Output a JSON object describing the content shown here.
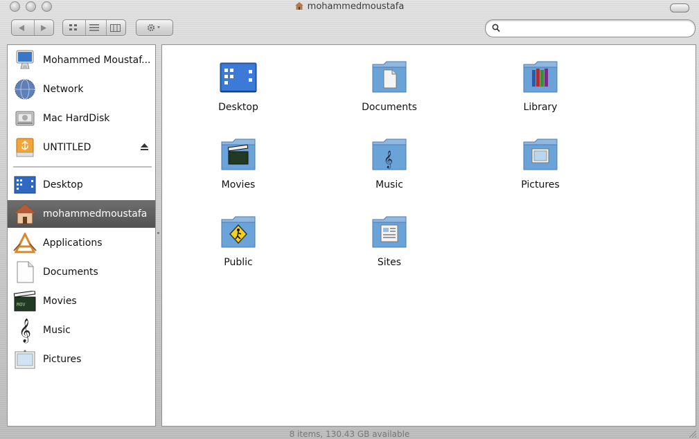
{
  "window": {
    "title": "mohammedmoustafa"
  },
  "toolbar": {
    "back_icon": "back-arrow-icon",
    "forward_icon": "forward-arrow-icon",
    "views": [
      "icon-view-icon",
      "list-view-icon",
      "column-view-icon"
    ],
    "action_icon": "gear-icon",
    "search_value": ""
  },
  "sidebar": {
    "devices": [
      {
        "label": "Mohammed Moustaf...",
        "icon": "computer-icon"
      },
      {
        "label": "Network",
        "icon": "network-globe-icon"
      },
      {
        "label": "Mac HardDisk",
        "icon": "hard-disk-icon"
      },
      {
        "label": "UNTITLED",
        "icon": "usb-drive-icon"
      }
    ],
    "places": [
      {
        "label": "Desktop",
        "icon": "desktop-icon"
      },
      {
        "label": "mohammedmoustafa",
        "icon": "home-icon",
        "selected": true
      },
      {
        "label": "Applications",
        "icon": "applications-icon"
      },
      {
        "label": "Documents",
        "icon": "documents-icon"
      },
      {
        "label": "Movies",
        "icon": "movies-icon"
      },
      {
        "label": "Music",
        "icon": "music-icon"
      },
      {
        "label": "Pictures",
        "icon": "pictures-icon"
      }
    ]
  },
  "content": {
    "items": [
      {
        "label": "Desktop",
        "icon": "desktop-folder-icon"
      },
      {
        "label": "Documents",
        "icon": "documents-folder-icon"
      },
      {
        "label": "Library",
        "icon": "library-folder-icon"
      },
      {
        "label": "Movies",
        "icon": "movies-folder-icon"
      },
      {
        "label": "Music",
        "icon": "music-folder-icon"
      },
      {
        "label": "Pictures",
        "icon": "pictures-folder-icon"
      },
      {
        "label": "Public",
        "icon": "public-folder-icon"
      },
      {
        "label": "Sites",
        "icon": "sites-folder-icon"
      }
    ]
  },
  "status": {
    "text": "8 items, 130.43 GB available"
  },
  "colors": {
    "folder_blue": "#6aa3d8",
    "selection_gray": "#5e5e5e"
  }
}
